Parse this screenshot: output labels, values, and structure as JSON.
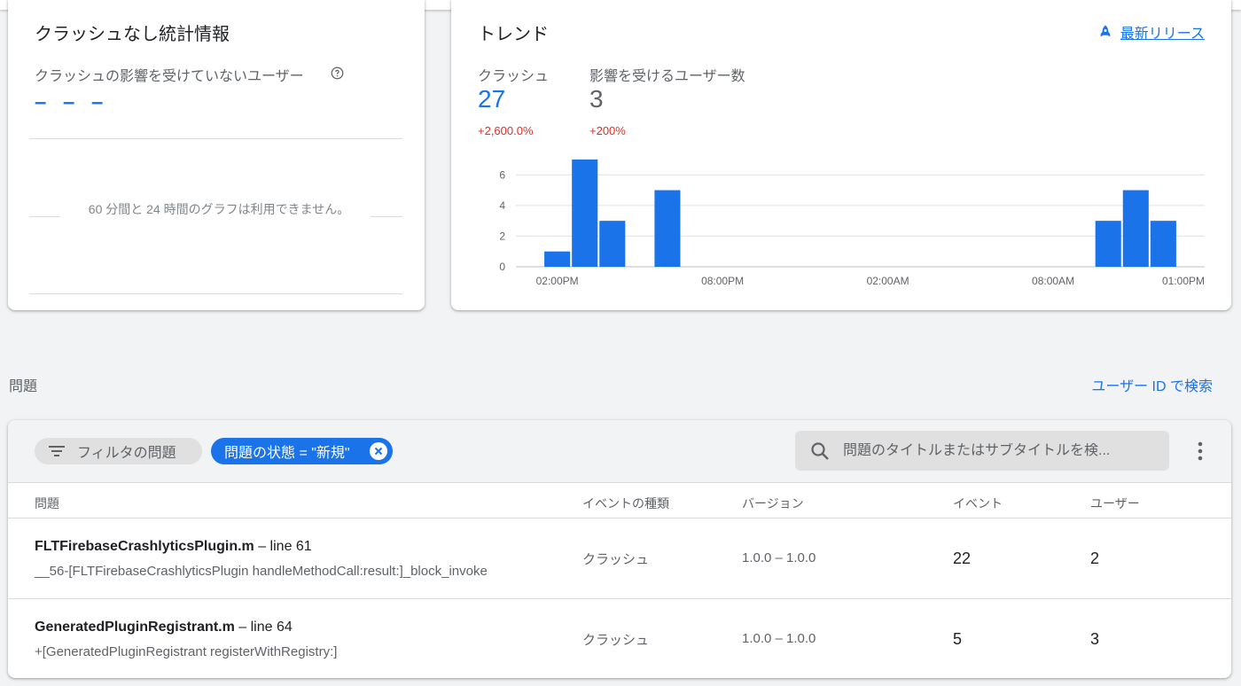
{
  "stats_card": {
    "title": "クラッシュなし統計情報",
    "subtitle": "クラッシュの影響を受けていないユーザー",
    "value": "– – –",
    "unavailable_text": "60 分間と 24 時間のグラフは利用できません。"
  },
  "trend_card": {
    "title": "トレンド",
    "release_link": "最新リリース",
    "metrics": [
      {
        "label": "クラッシュ",
        "value": "27",
        "delta": "+2,600.0%",
        "color": "#1a73e8"
      },
      {
        "label": "影響を受けるユーザー数",
        "value": "3",
        "delta": "+200%",
        "color": "#5f6368"
      }
    ]
  },
  "chart_data": {
    "type": "bar",
    "x": [
      "01:00PM",
      "02:00PM",
      "03:00PM",
      "04:00PM",
      "05:00PM",
      "06:00PM",
      "07:00PM",
      "08:00PM",
      "09:00PM",
      "10:00PM",
      "11:00PM",
      "12:00AM",
      "01:00AM",
      "02:00AM",
      "03:00AM",
      "04:00AM",
      "05:00AM",
      "06:00AM",
      "07:00AM",
      "08:00AM",
      "09:00AM",
      "10:00AM",
      "11:00AM",
      "12:00PM",
      "01:00PM"
    ],
    "values": [
      0,
      1,
      7,
      3,
      0,
      5,
      0,
      0,
      0,
      0,
      0,
      0,
      0,
      0,
      0,
      0,
      0,
      0,
      0,
      0,
      0,
      3,
      5,
      3,
      0
    ],
    "x_tick_labels": [
      "02:00PM",
      "08:00PM",
      "02:00AM",
      "08:00AM",
      "01:00PM"
    ],
    "y_ticks": [
      0,
      2,
      4,
      6
    ],
    "ylim": [
      0,
      7
    ],
    "bar_color": "#1a73e8",
    "grid": true
  },
  "issues_section": {
    "label": "問題",
    "search_user_link": "ユーザー ID で検索"
  },
  "toolbar": {
    "filter_chip": "フィルタの問題",
    "status_chip": "問題の状態 = \"新規\"",
    "search_placeholder": "問題のタイトルまたはサブタイトルを検..."
  },
  "table": {
    "headers": {
      "issue": "問題",
      "event_type": "イベントの種類",
      "version": "バージョン",
      "events": "イベント",
      "users": "ユーザー"
    },
    "rows": [
      {
        "file": "FLTFirebaseCrashlyticsPlugin.m",
        "line": " – line 61",
        "subtitle": "__56-[FLTFirebaseCrashlyticsPlugin handleMethodCall:result:]_block_invoke",
        "event_type": "クラッシュ",
        "version": "1.0.0 – 1.0.0",
        "events": "22",
        "users": "2"
      },
      {
        "file": "GeneratedPluginRegistrant.m",
        "line": " – line 64",
        "subtitle": "+[GeneratedPluginRegistrant registerWithRegistry:]",
        "event_type": "クラッシュ",
        "version": "1.0.0 – 1.0.0",
        "events": "5",
        "users": "3"
      }
    ]
  }
}
